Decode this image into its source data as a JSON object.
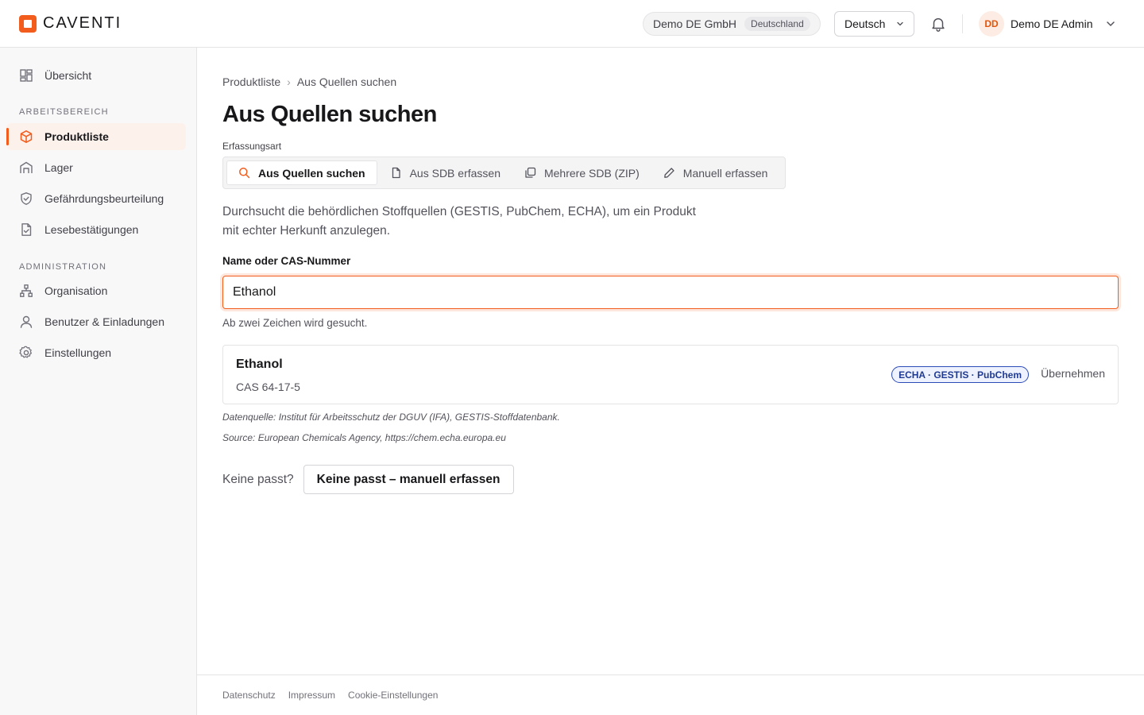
{
  "app": {
    "brand": "CAVENTI",
    "accent_color": "#f25c1c"
  },
  "header": {
    "org_name": "Demo DE GmbH",
    "org_country": "Deutschland",
    "language": "Deutsch",
    "user_initials": "DD",
    "user_name": "Demo DE Admin"
  },
  "sidebar": {
    "overview": "Übersicht",
    "section_work": "ARBEITSBEREICH",
    "section_admin": "ADMINISTRATION",
    "items": [
      {
        "label": "Produktliste",
        "icon": "cube-icon",
        "active": true
      },
      {
        "label": "Lager",
        "icon": "warehouse-icon"
      },
      {
        "label": "Gefährdungsbeurteilung",
        "icon": "shield-check-icon"
      },
      {
        "label": "Lesebestätigungen",
        "icon": "file-check-icon"
      },
      {
        "label": "Organisation",
        "icon": "org-chart-icon"
      },
      {
        "label": "Benutzer & Einladungen",
        "icon": "user-icon"
      },
      {
        "label": "Einstellungen",
        "icon": "gear-icon"
      }
    ]
  },
  "main": {
    "breadcrumb": {
      "parent": "Produktliste",
      "current": "Aus Quellen suchen"
    },
    "title": "Aus Quellen suchen",
    "capture_label": "Erfassungsart",
    "tabs": [
      {
        "label": "Aus Quellen suchen",
        "icon": "search-icon",
        "active": true
      },
      {
        "label": "Aus SDB erfassen",
        "icon": "document-icon"
      },
      {
        "label": "Mehrere SDB (ZIP)",
        "icon": "copy-icon"
      },
      {
        "label": "Manuell erfassen",
        "icon": "pencil-icon"
      }
    ],
    "description": "Durchsucht die behördlichen Stoffquellen (GESTIS, PubChem, ECHA), um ein Produkt mit echter Herkunft anzulegen.",
    "field_label": "Name oder CAS-Nummer",
    "search_value": "Ethanol",
    "hint": "Ab zwei Zeichen wird gesucht.",
    "result": {
      "name": "Ethanol",
      "cas": "CAS 64-17-5",
      "sources": "ECHA · GESTIS · PubChem",
      "action": "Übernehmen"
    },
    "source_note_1": "Datenquelle: Institut für Arbeitsschutz der DGUV (IFA), GESTIS-Stoffdatenbank.",
    "source_note_2": "Source: European Chemicals Agency, https://chem.echa.europa.eu",
    "no_match_text": "Keine passt?",
    "no_match_button": "Keine passt – manuell erfassen"
  },
  "footer": {
    "links": [
      "Datenschutz",
      "Impressum",
      "Cookie-Einstellungen"
    ]
  }
}
